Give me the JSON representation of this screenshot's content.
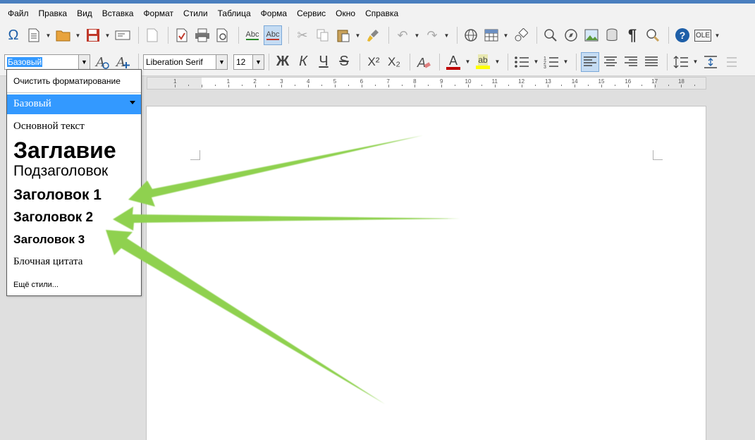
{
  "menu": [
    "Файл",
    "Правка",
    "Вид",
    "Вставка",
    "Формат",
    "Стили",
    "Таблица",
    "Форма",
    "Сервис",
    "Окно",
    "Справка"
  ],
  "toolbar": {
    "special_char_icon": "Ω",
    "spelling_icon": "Abc",
    "autospell_icon": "Abc",
    "pilcrow_icon": "¶",
    "help_icon": "?",
    "ole_icon": "OLE"
  },
  "formatting": {
    "style_value": "Базовый",
    "font_name": "Liberation Serif",
    "font_size": "12",
    "bold_label": "Ж",
    "italic_label": "К",
    "underline_label": "Ч",
    "strike_label": "S",
    "superscript_label": "X²",
    "subscript_label": "X₂",
    "font_color_label": "A",
    "highlight_label": "ab",
    "font_color": "#c00000",
    "highlight_color": "#ffff00"
  },
  "ruler": {
    "numbers": [
      "1",
      "1",
      "2",
      "3",
      "4",
      "5",
      "6",
      "7",
      "8",
      "9",
      "10",
      "11",
      "12",
      "13",
      "14",
      "15",
      "16",
      "17",
      "18"
    ]
  },
  "style_dropdown": {
    "clear": "Очистить форматирование",
    "selected": "Базовый",
    "items": [
      "Основной текст",
      "Заглавие",
      "Подзаголовок",
      "Заголовок 1",
      "Заголовок 2",
      "Заголовок 3",
      "Блочная цитата"
    ],
    "more": "Ещё стили..."
  },
  "colors": {
    "accent": "#3399ff",
    "arrow": "#8fd14f",
    "title_strip": "#4a7fbf"
  }
}
